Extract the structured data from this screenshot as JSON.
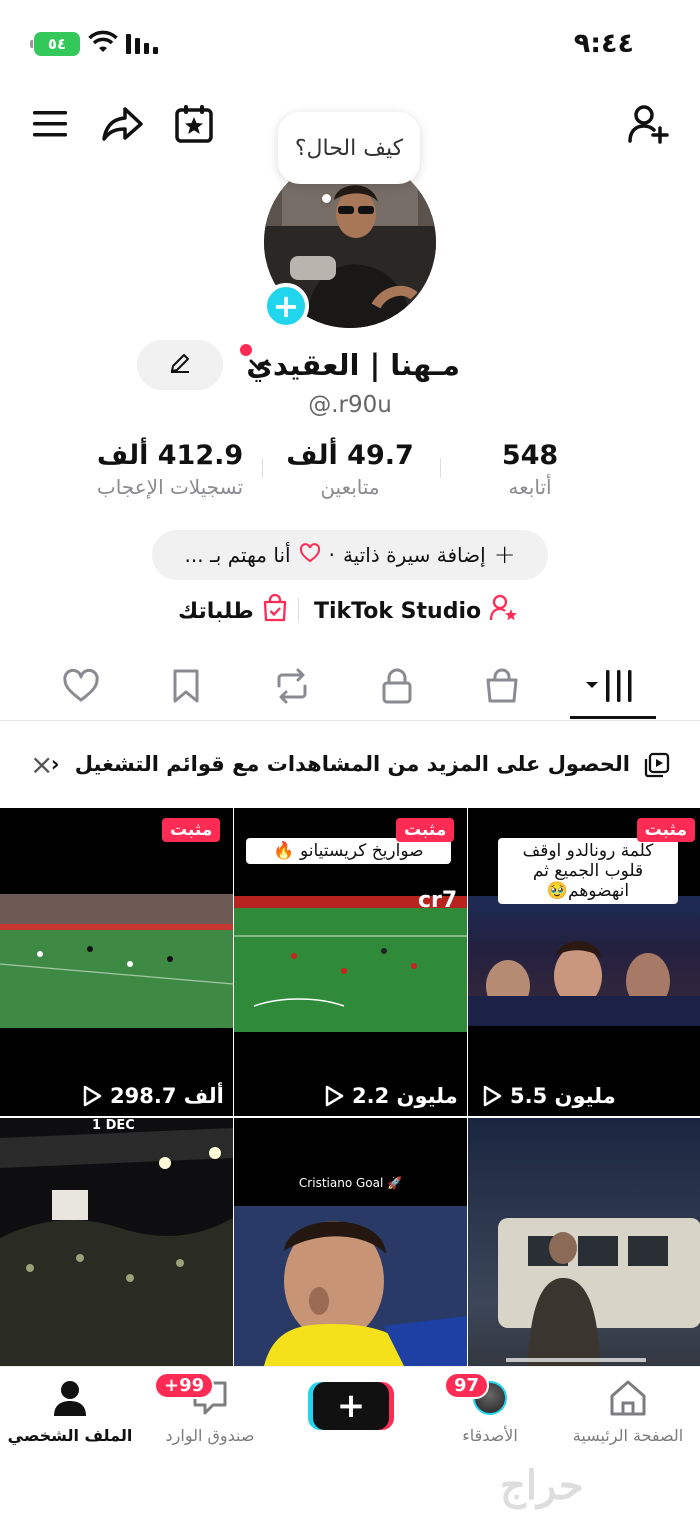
{
  "status_bar": {
    "time": "٩:٤٤",
    "battery": "٥٤"
  },
  "header": {
    "bubble_text": "كيف الحال؟"
  },
  "profile": {
    "name": "مـهنا | العقيدي",
    "handle": "@.r90u"
  },
  "stats": [
    {
      "value": "548",
      "label": "أتابعه"
    },
    {
      "value": "49.7 ألف",
      "label": "متابعين"
    },
    {
      "value": "412.9 ألف",
      "label": "تسجيلات الإعجاب"
    }
  ],
  "bio": {
    "add_bio": "إضافة سيرة ذاتية",
    "separator": "·",
    "interest": "أنا مهتم بـ ..."
  },
  "studio": {
    "tiktok_studio": "TikTok Studio",
    "orders": "طلباتك"
  },
  "banner": {
    "text": "الحصول على المزيد من المشاهدات مع قوائم التشغيل",
    "arrow": "‹",
    "close": "×"
  },
  "videos": [
    {
      "pinned": "مثبت",
      "views": "5.5 مليون",
      "caption": "كلمة رونالدو اوقف قلوب الجميع ثم انهضوهم🥹"
    },
    {
      "pinned": "مثبت",
      "views": "2.2 مليون",
      "caption": "صواريخ كريستيانو 🔥",
      "overlay": "cr7"
    },
    {
      "pinned": "مثبت",
      "views": "298.7 ألف"
    },
    {
      "overlay": ""
    },
    {
      "overlay": "Cristiano Goal 🚀"
    },
    {
      "overlay": "1 DEC"
    }
  ],
  "nav": {
    "home": "الصفحة الرئيسية",
    "friends": "الأصدقاء",
    "friends_badge": "97",
    "create": "+",
    "inbox": "صندوق الوارد",
    "inbox_badge": "99+",
    "profile": "الملف الشخصي"
  },
  "colors": {
    "accent": "#fe2c55",
    "cyan": "#20d5ec"
  }
}
